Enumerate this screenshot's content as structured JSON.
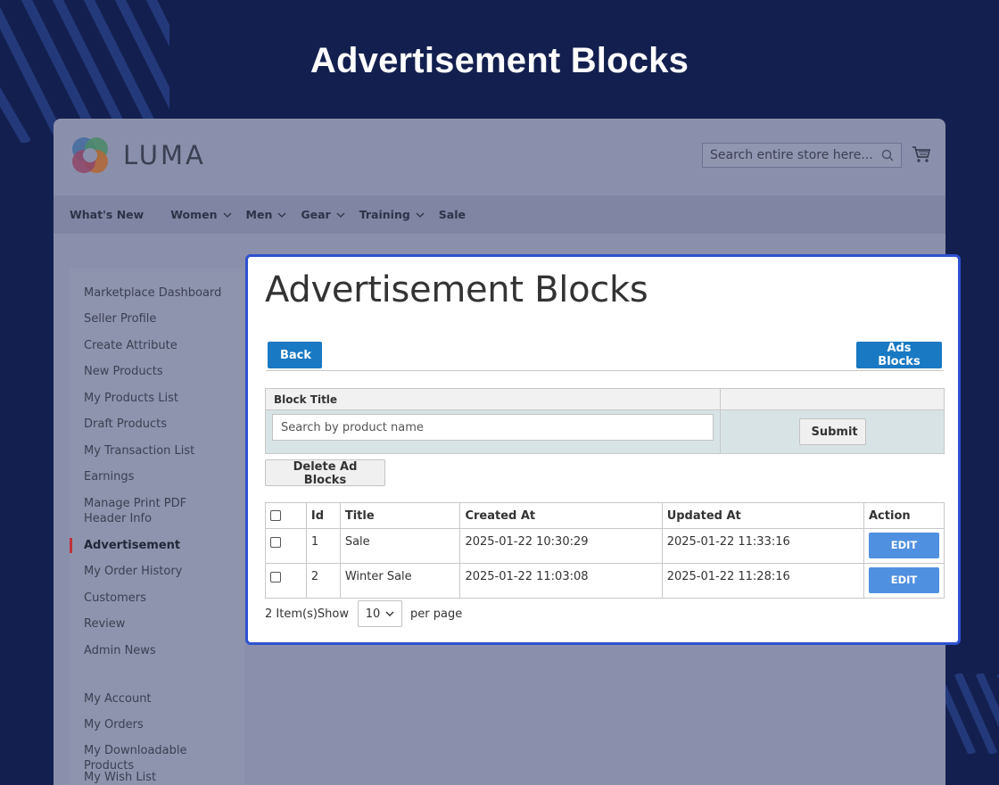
{
  "page": {
    "heading": "Advertisement Blocks"
  },
  "store": {
    "logo_text": "LUMA",
    "search_placeholder": "Search entire store here...",
    "nav": [
      "What's New",
      "Women",
      "Men",
      "Gear",
      "Training",
      "Sale"
    ]
  },
  "sidebar": {
    "items": [
      "Marketplace Dashboard",
      "Seller Profile",
      "Create Attribute",
      "New Products",
      "My Products List",
      "Draft Products",
      "My Transaction List",
      "Earnings",
      "Manage Print PDF Header Info",
      "Advertisement",
      "My Order History",
      "Customers",
      "Review",
      "Admin News",
      "My Account",
      "My Orders",
      "My Downloadable Products",
      "My Wish List"
    ],
    "active": "Advertisement"
  },
  "panel": {
    "title": "Advertisement Blocks",
    "back_label": "Back",
    "ads_blocks_label": "Ads Blocks",
    "filter_header": "Block Title",
    "filter_placeholder": "Search by product name",
    "submit_label": "Submit",
    "delete_label": "Delete Ad Blocks",
    "columns": [
      "Id",
      "Title",
      "Created At",
      "Updated At",
      "Action"
    ],
    "rows": [
      {
        "id": "1",
        "title": "Sale",
        "created": "2025-01-22 10:30:29",
        "updated": "2025-01-22 11:33:16",
        "action": "EDIT"
      },
      {
        "id": "2",
        "title": "Winter Sale",
        "created": "2025-01-22 11:03:08",
        "updated": "2025-01-22 11:28:16",
        "action": "EDIT"
      }
    ],
    "pager": {
      "count_text": "2 Item(s)Show",
      "per_page_value": "10",
      "per_page_suffix": "per page"
    }
  }
}
